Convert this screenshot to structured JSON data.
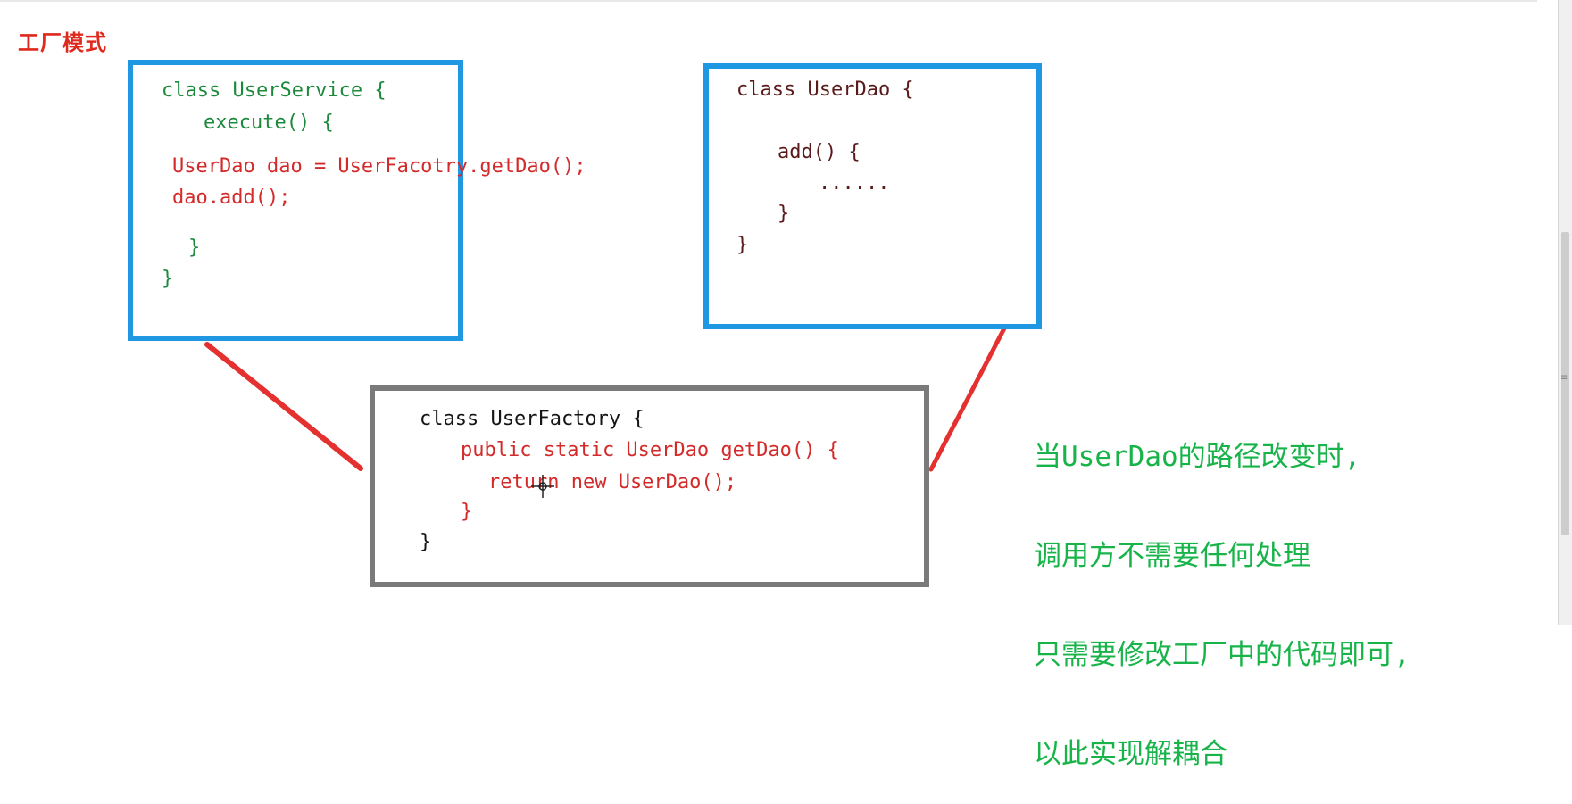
{
  "title": "工厂模式",
  "user_service": {
    "lines": [
      "class UserService {",
      "execute() {",
      "UserDao dao = UserFacotry.getDao();",
      "dao.add();",
      "}",
      "}"
    ]
  },
  "user_dao": {
    "lines": [
      "class UserDao {",
      "add() {",
      "......",
      "}",
      "}"
    ]
  },
  "user_factory": {
    "lines": [
      "class UserFactory {",
      "public static UserDao getDao() {",
      "return new UserDao();",
      "}",
      "}"
    ]
  },
  "note": {
    "lines": [
      "当UserDao的路径改变时,",
      "调用方不需要任何处理",
      "只需要修改工厂中的代码即可,",
      "以此实现解耦合"
    ]
  },
  "colors": {
    "blue_border": "#1f97e3",
    "gray_border": "#7a7a7a",
    "connector": "#e53030",
    "title": "#e0291d",
    "note": "#18b44a"
  }
}
